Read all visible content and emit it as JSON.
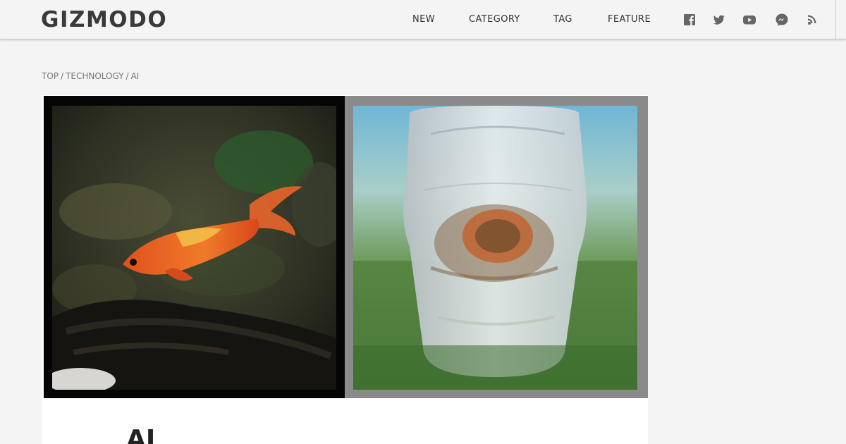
{
  "header": {
    "logo": "GIZMODO",
    "nav": [
      {
        "label": "NEW"
      },
      {
        "label": "CATEGORY"
      },
      {
        "label": "TAG"
      },
      {
        "label": "FEATURE"
      }
    ],
    "social": [
      {
        "icon": "facebook-icon"
      },
      {
        "icon": "twitter-icon"
      },
      {
        "icon": "youtube-icon"
      },
      {
        "icon": "messenger-icon"
      },
      {
        "icon": "rss-icon"
      }
    ]
  },
  "breadcrumb": {
    "items": [
      "TOP",
      "TECHNOLOGY",
      "AI"
    ],
    "separator": "/"
  },
  "article": {
    "title": "AI"
  },
  "colors": {
    "background": "#f4f4f4",
    "card": "#ffffff",
    "text": "#333333",
    "muted": "#777777",
    "icon": "#666666"
  }
}
